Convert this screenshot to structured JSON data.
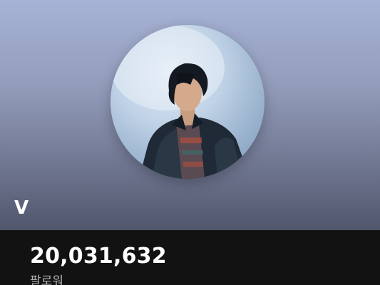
{
  "artist": {
    "name": "V",
    "followers_count": "20,031,632",
    "followers_label": "팔로워"
  },
  "colors": {
    "header_top": "#a7b3d6",
    "header_bottom": "#50566b",
    "page_background": "#121212",
    "secondary_text": "#b3b3b3"
  },
  "icons": {
    "avatar": "artist-profile-photo"
  }
}
